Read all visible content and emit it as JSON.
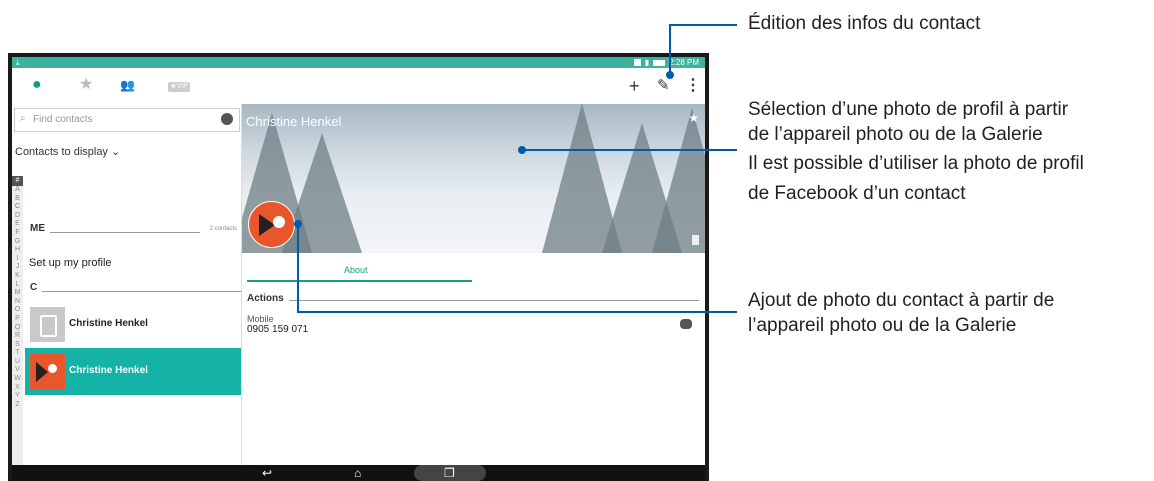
{
  "status_bar": {
    "download_icon": "download-icon",
    "time": "2:28 PM"
  },
  "tabs": [
    {
      "name": "contacts",
      "icon": "person-icon",
      "active": true
    },
    {
      "name": "favorites",
      "icon": "star-icon",
      "active": false
    },
    {
      "name": "groups",
      "icon": "group-icon",
      "active": false
    },
    {
      "name": "vip",
      "label": "★VIP",
      "active": false
    }
  ],
  "toolbar": {
    "add_icon": "plus-icon",
    "edit_icon": "pencil-icon",
    "menu_icon": "more-vert-icon"
  },
  "search": {
    "placeholder": "Find contacts"
  },
  "contacts_to_display": "Contacts to display",
  "alphabet": [
    "#",
    "A",
    "B",
    "C",
    "D",
    "E",
    "F",
    "G",
    "H",
    "I",
    "J",
    "K",
    "L",
    "M",
    "N",
    "O",
    "P",
    "Q",
    "R",
    "S",
    "T",
    "U",
    "V",
    "W",
    "X",
    "Y",
    "Z"
  ],
  "sections": {
    "me": {
      "label": "ME",
      "count": "2 contacts"
    },
    "c": {
      "label": "C"
    }
  },
  "setup_profile": "Set up my profile",
  "contacts": [
    {
      "name": "Christine Henkel",
      "selected": false,
      "avatar": "sim-card-icon"
    },
    {
      "name": "Christine Henkel",
      "selected": true,
      "avatar": "zenfone-avatar-icon"
    }
  ],
  "detail": {
    "name": "Christine Henkel",
    "tab_label": "About",
    "actions_heading": "Actions",
    "phone_type": "Mobile",
    "phone_number": "0905 159 071"
  },
  "colors": {
    "accent": "#14a085",
    "status_bar": "#3bb39f",
    "selected_row": "#14b2a7",
    "callout_line": "#005baa"
  },
  "callouts": {
    "edit": "Édition des infos du contact",
    "cover_1": "Sélection d’une photo de profil à partir",
    "cover_2": "de l’appareil photo ou de la Galerie",
    "cover_3": "Il est possible d’utiliser la photo de profil",
    "cover_4": "de Facebook d’un contact",
    "photo_1": "Ajout de photo du contact à partir de",
    "photo_2": "l’appareil photo ou de la Galerie"
  }
}
